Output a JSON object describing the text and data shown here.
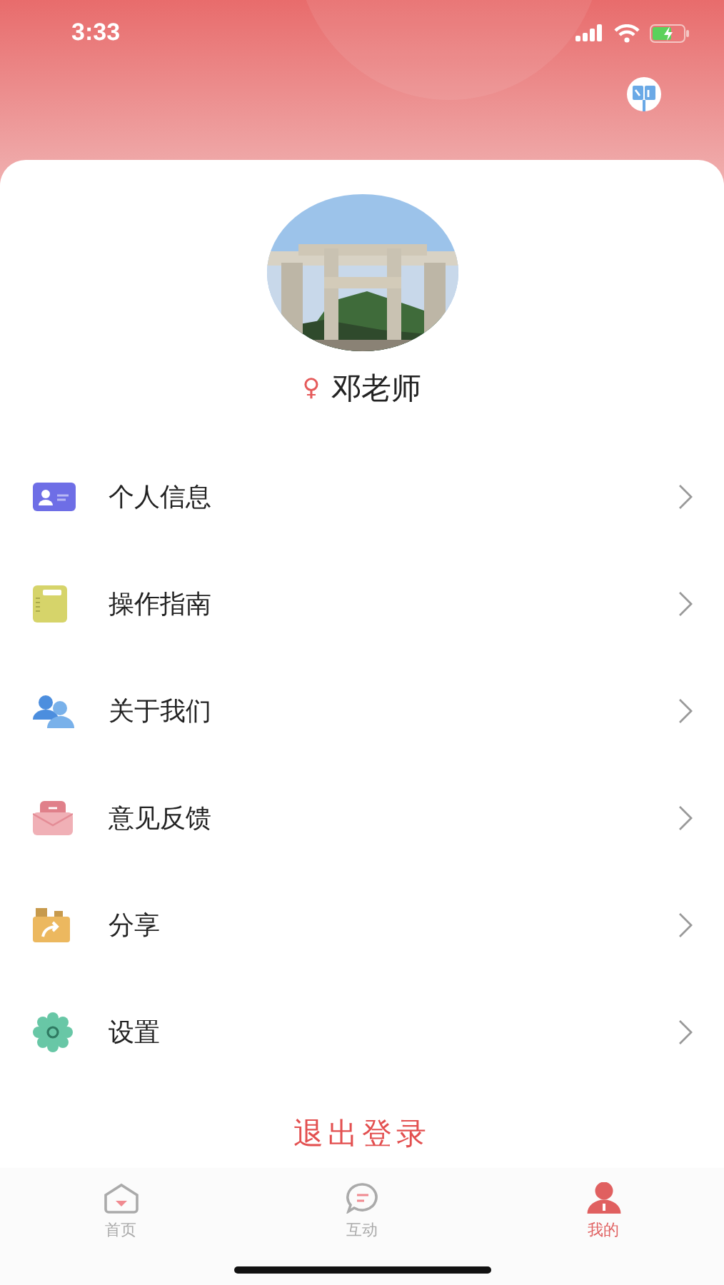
{
  "status_bar": {
    "time": "3:33"
  },
  "profile": {
    "name": "邓老师",
    "gender_symbol": "♀"
  },
  "menu": [
    {
      "kind": "id-card",
      "label": "个人信息"
    },
    {
      "kind": "notebook",
      "label": "操作指南"
    },
    {
      "kind": "people",
      "label": "关于我们"
    },
    {
      "kind": "mail",
      "label": "意见反馈"
    },
    {
      "kind": "share",
      "label": "分享"
    },
    {
      "kind": "gear",
      "label": "设置"
    }
  ],
  "logout": {
    "label": "退出登录"
  },
  "tabs": [
    {
      "kind": "home",
      "label": "首页",
      "selected": false
    },
    {
      "kind": "chat",
      "label": "互动",
      "selected": false
    },
    {
      "kind": "person",
      "label": "我的",
      "selected": true
    }
  ]
}
